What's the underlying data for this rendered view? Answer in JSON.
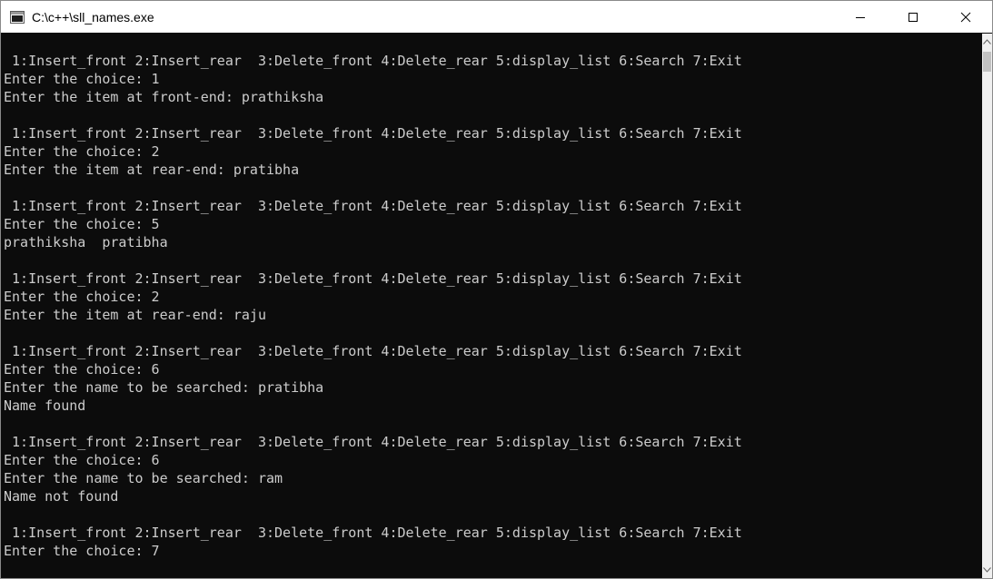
{
  "window": {
    "title": "C:\\c++\\sll_names.exe",
    "icon": "console-app-icon"
  },
  "controls": {
    "minimize": "minimize-icon",
    "maximize": "maximize-icon",
    "close": "close-icon"
  },
  "console": {
    "lines": [
      "",
      " 1:Insert_front 2:Insert_rear  3:Delete_front 4:Delete_rear 5:display_list 6:Search 7:Exit",
      "Enter the choice: 1",
      "Enter the item at front-end: prathiksha",
      "",
      " 1:Insert_front 2:Insert_rear  3:Delete_front 4:Delete_rear 5:display_list 6:Search 7:Exit",
      "Enter the choice: 2",
      "Enter the item at rear-end: pratibha",
      "",
      " 1:Insert_front 2:Insert_rear  3:Delete_front 4:Delete_rear 5:display_list 6:Search 7:Exit",
      "Enter the choice: 5",
      "prathiksha  pratibha",
      "",
      " 1:Insert_front 2:Insert_rear  3:Delete_front 4:Delete_rear 5:display_list 6:Search 7:Exit",
      "Enter the choice: 2",
      "Enter the item at rear-end: raju",
      "",
      " 1:Insert_front 2:Insert_rear  3:Delete_front 4:Delete_rear 5:display_list 6:Search 7:Exit",
      "Enter the choice: 6",
      "Enter the name to be searched: pratibha",
      "Name found",
      "",
      " 1:Insert_front 2:Insert_rear  3:Delete_front 4:Delete_rear 5:display_list 6:Search 7:Exit",
      "Enter the choice: 6",
      "Enter the name to be searched: ram",
      "Name not found",
      "",
      " 1:Insert_front 2:Insert_rear  3:Delete_front 4:Delete_rear 5:display_list 6:Search 7:Exit",
      "Enter the choice: 7"
    ]
  },
  "colors": {
    "console_background": "#0c0c0c",
    "console_text": "#cccccc",
    "titlebar_background": "#ffffff"
  }
}
